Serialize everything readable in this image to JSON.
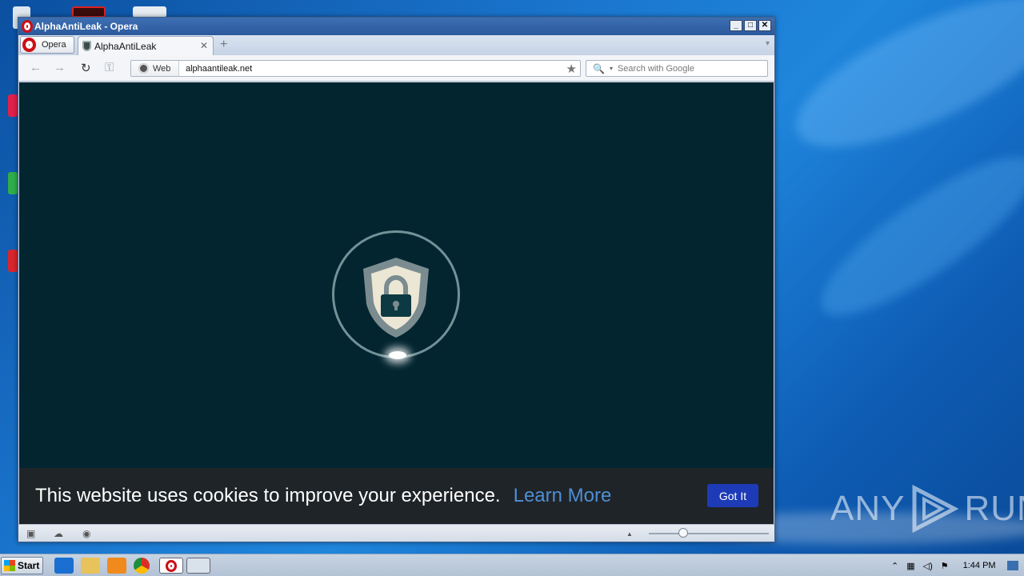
{
  "window": {
    "title": "AlphaAntiLeak - Opera",
    "controls": {
      "minimize": "_",
      "maximize": "□",
      "close": "✕"
    }
  },
  "tabbar": {
    "menu_label": "Opera",
    "tabs": [
      {
        "label": "AlphaAntiLeak",
        "close": "✕"
      }
    ],
    "new_tab": "+",
    "tab_menu": "▾"
  },
  "toolbar": {
    "back": "←",
    "forward": "→",
    "reload": "↻",
    "key": "⚿",
    "address": {
      "badge": "Web",
      "url": "alphaantileak.net",
      "bookmark": "★"
    },
    "search": {
      "placeholder": "Search with Google",
      "icon": "🔍",
      "caret": "▾"
    }
  },
  "page": {
    "cookie_notice": {
      "message": "This website uses cookies to improve your experience.",
      "learn_more": "Learn More",
      "accept": "Got It"
    }
  },
  "statusbar": {
    "zoom_up": "▲"
  },
  "taskbar": {
    "start": "Start",
    "clock": "1:44 PM"
  },
  "watermark": {
    "text_left": "ANY",
    "text_right": "RUN"
  },
  "colors": {
    "page_bg": "#02252f",
    "cookie_bar_bg": "#1f2428",
    "learn_more": "#4f8ed4",
    "got_it_bg": "#1e3bb7",
    "opera_red": "#cc0f16"
  }
}
